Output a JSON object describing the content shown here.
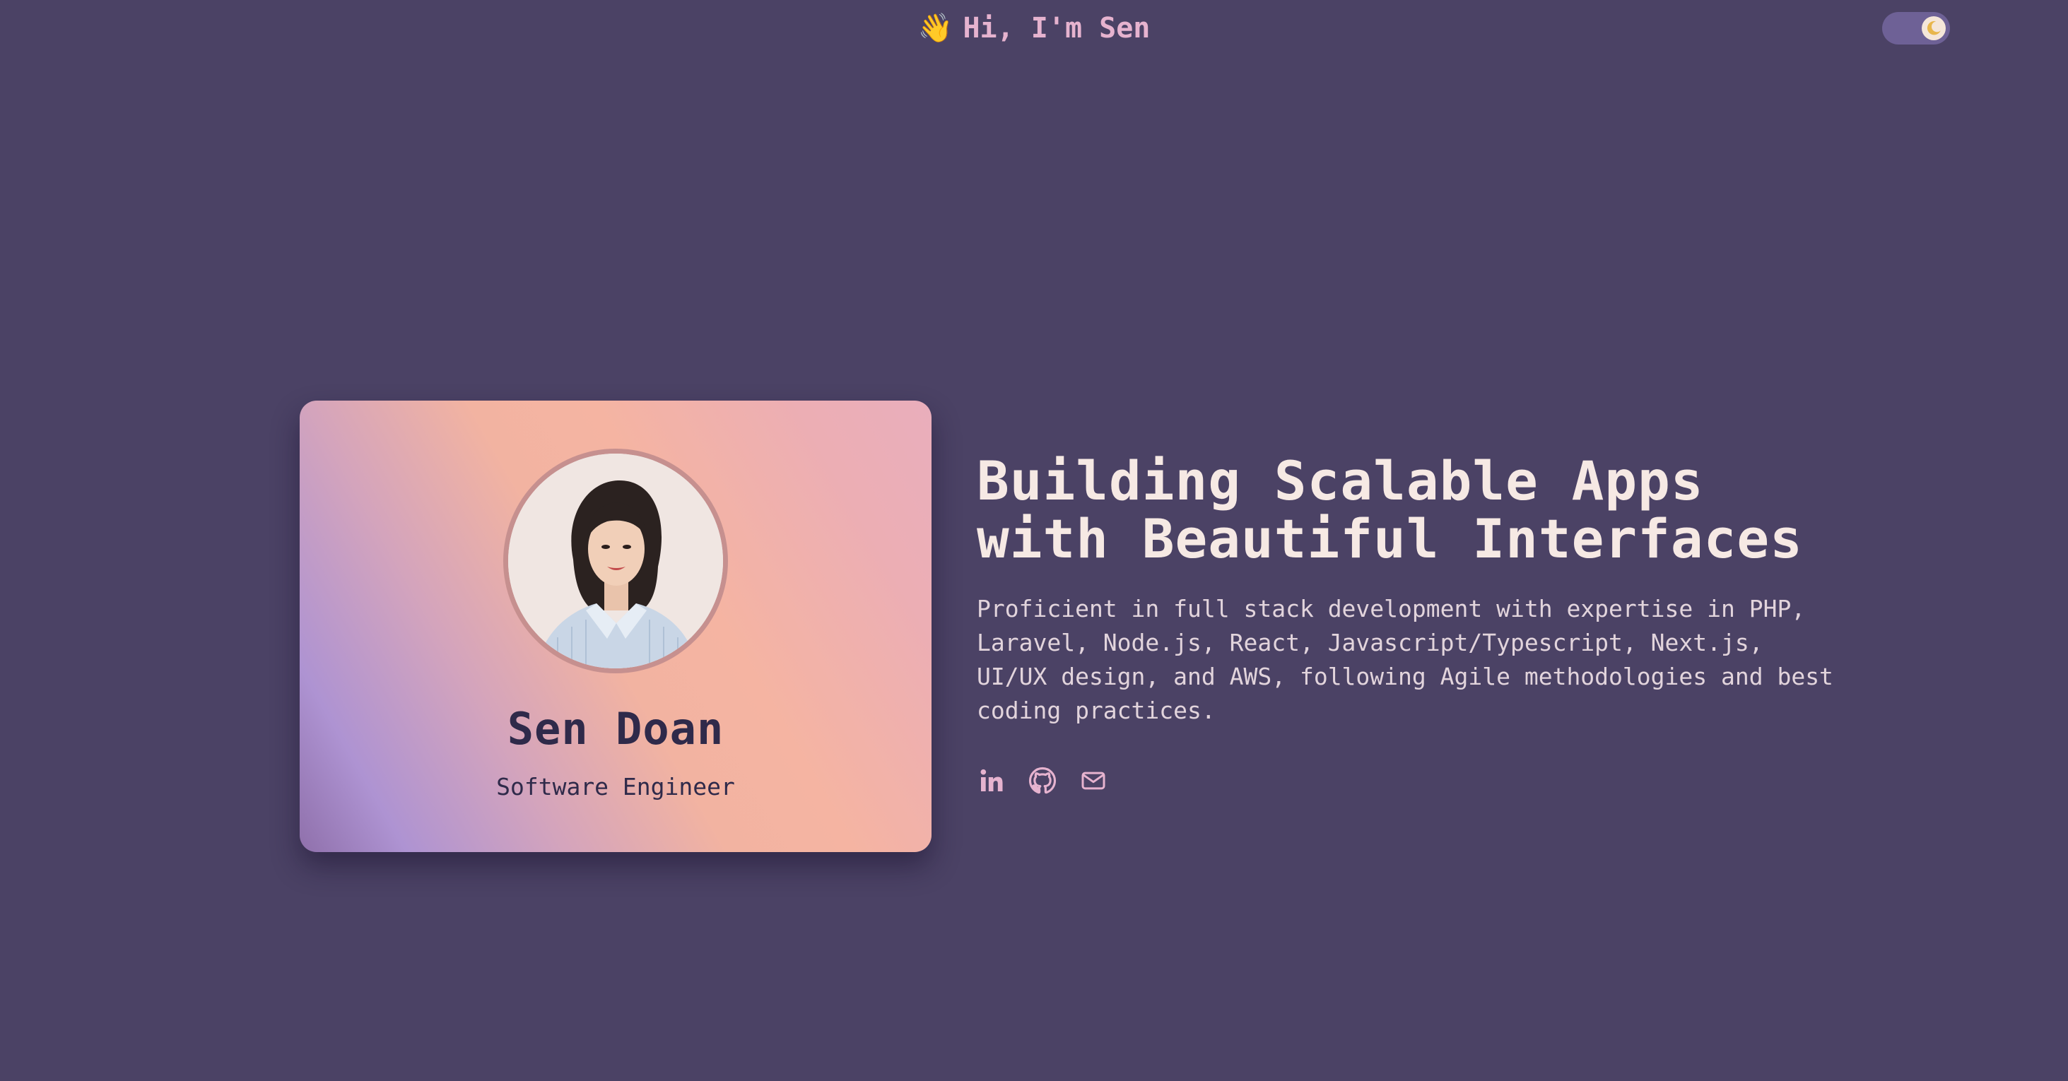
{
  "header": {
    "greeting": "Hi, I'm Sen",
    "wave_icon": "waving-hand-icon",
    "theme_toggle": {
      "state": "dark",
      "icon": "moon-icon"
    }
  },
  "profile_card": {
    "name": "Sen Doan",
    "role": "Software Engineer"
  },
  "hero": {
    "title_line1": "Building Scalable Apps",
    "title_line2": "with Beautiful Interfaces",
    "description": "Proficient in full stack development with expertise in PHP, Laravel, Node.js, React, Javascript/Typescript, Next.js, UI/UX design, and AWS, following Agile methodologies and best coding practices."
  },
  "social_links": [
    {
      "icon": "linkedin-icon"
    },
    {
      "icon": "github-icon"
    },
    {
      "icon": "mail-icon"
    }
  ],
  "colors": {
    "background": "#4b4265",
    "accent": "#e6b3cf",
    "heading": "#f6e9e4",
    "card_text": "#2f2a4a"
  }
}
